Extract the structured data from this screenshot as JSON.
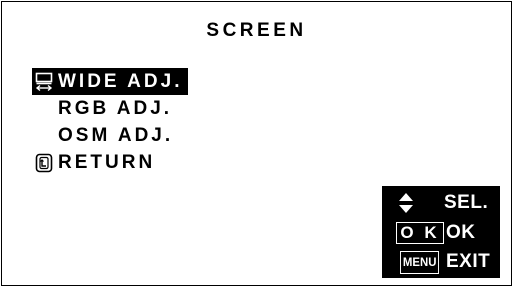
{
  "screen": {
    "title": "SCREEN"
  },
  "menu": {
    "items": [
      {
        "label": "WIDE ADJ.",
        "selected": true,
        "icon": "wide-adjust-icon"
      },
      {
        "label": "RGB ADJ.",
        "selected": false,
        "icon": null
      },
      {
        "label": "OSM ADJ.",
        "selected": false,
        "icon": null
      },
      {
        "label": "RETURN",
        "selected": false,
        "icon": "return-icon"
      }
    ]
  },
  "legend": {
    "select": {
      "icon": "up-down-arrows-icon",
      "label": "SEL."
    },
    "ok": {
      "key": "O K",
      "label": "OK"
    },
    "exit": {
      "key": "MENU",
      "label": "EXIT"
    }
  },
  "colors": {
    "background": "#ffffff",
    "foreground": "#000000",
    "highlight_background": "#000000",
    "highlight_text": "#ffffff"
  }
}
